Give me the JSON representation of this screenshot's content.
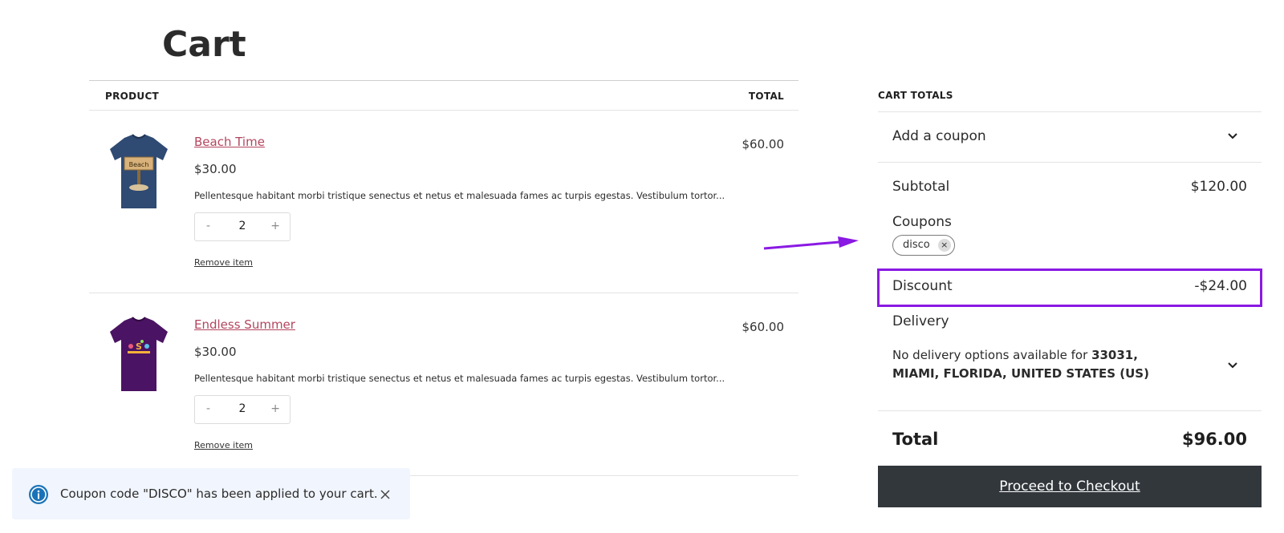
{
  "page": {
    "title": "Cart"
  },
  "cart_table": {
    "product_header": "PRODUCT",
    "total_header": "TOTAL",
    "items": [
      {
        "name": "Beach Time",
        "unit_price": "$30.00",
        "description": "Pellentesque habitant morbi tristique senectus et netus et malesuada fames ac turpis egestas. Vestibulum tortor...",
        "quantity": "2",
        "minus_label": "-",
        "plus_label": "+",
        "remove_label": "Remove item",
        "line_total": "$60.00",
        "shirt_color": "#2f4a73",
        "thumbnail": "beach-time-tshirt"
      },
      {
        "name": "Endless Summer",
        "unit_price": "$30.00",
        "description": "Pellentesque habitant morbi tristique senectus et netus et malesuada fames ac turpis egestas. Vestibulum tortor...",
        "quantity": "2",
        "minus_label": "-",
        "plus_label": "+",
        "remove_label": "Remove item",
        "line_total": "$60.00",
        "shirt_color": "#4b1363",
        "thumbnail": "endless-summer-tshirt"
      }
    ]
  },
  "totals": {
    "heading": "CART TOTALS",
    "add_coupon_label": "Add a coupon",
    "subtotal_label": "Subtotal",
    "subtotal_value": "$120.00",
    "coupons_label": "Coupons",
    "applied_coupon": "disco",
    "coupon_remove_glyph": "×",
    "discount_label": "Discount",
    "discount_value": "-$24.00",
    "delivery_label": "Delivery",
    "delivery_prefix": "No delivery options available for ",
    "delivery_location": "33031, MIAMI, FLORIDA, UNITED STATES (US)",
    "total_label": "Total",
    "total_value": "$96.00",
    "checkout_label": "Proceed to Checkout"
  },
  "notice": {
    "text": "Coupon code \"DISCO\" has been applied to your cart.",
    "icon": "info-icon",
    "close_icon": "close-icon"
  },
  "colors": {
    "link": "#b3455e",
    "highlight": "#8a19e3",
    "checkout_bg": "#32373c",
    "notice_bg": "#f1f5fd",
    "info_icon": "#1a73b8"
  }
}
